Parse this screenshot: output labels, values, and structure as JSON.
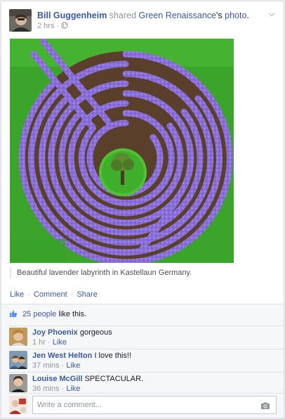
{
  "post": {
    "author": "Bill Guggenheim",
    "action_text": "shared",
    "source": "Green Renaissance",
    "source_suffix": "'s",
    "object": "photo",
    "end_punct": ".",
    "time": "2 hrs",
    "meta_sep": "·",
    "privacy_icon": "globe-icon",
    "caption": "Beautiful lavender labyrinth in Kastellaun Germany."
  },
  "actions": {
    "like": "Like",
    "comment": "Comment",
    "share": "Share",
    "sep": "·"
  },
  "likes": {
    "count_text": "25 people",
    "suffix": "like this."
  },
  "comments": [
    {
      "author": "Joy Phoenix",
      "text": "gorgeous",
      "time": "1 hr",
      "sep": "·",
      "like": "Like"
    },
    {
      "author": "Jen West Helton",
      "text": "I love this!!",
      "time": "37 mins",
      "sep": "·",
      "like": "Like"
    },
    {
      "author": "Louise McGill",
      "text": "SPECTACULAR.",
      "time": "36 mins",
      "sep": "·",
      "like": "Like"
    }
  ],
  "composer": {
    "placeholder": "Write a comment..."
  },
  "colors": {
    "link": "#3b5998",
    "lavender": "#8c72d6",
    "grass": "#3fae2a"
  }
}
